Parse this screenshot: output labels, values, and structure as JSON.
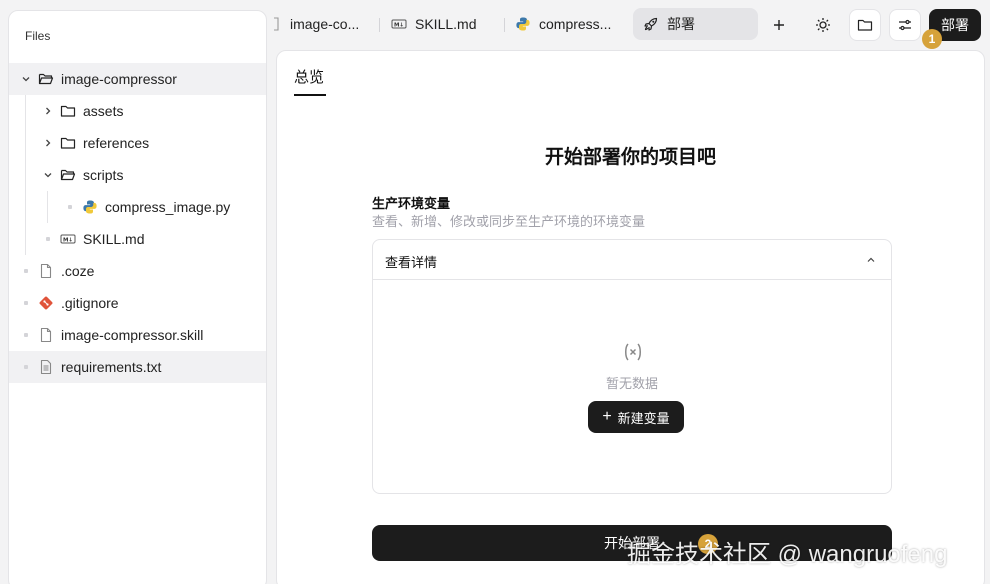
{
  "sidebar": {
    "title": "Files",
    "tree": [
      {
        "label": "image-compressor",
        "type": "folder-open",
        "expanded": true,
        "selected": true
      },
      {
        "label": "assets",
        "type": "folder"
      },
      {
        "label": "references",
        "type": "folder"
      },
      {
        "label": "scripts",
        "type": "folder-open",
        "expanded": true
      },
      {
        "label": "compress_image.py",
        "type": "python-file"
      },
      {
        "label": "SKILL.md",
        "type": "markdown-file"
      },
      {
        "label": ".coze",
        "type": "file"
      },
      {
        "label": ".gitignore",
        "type": "git-file"
      },
      {
        "label": "image-compressor.skill",
        "type": "file"
      },
      {
        "label": "requirements.txt",
        "type": "text-file",
        "hovered": true
      }
    ]
  },
  "tabs": [
    {
      "label": "image-co...",
      "icon": "file-icon"
    },
    {
      "label": "SKILL.md",
      "icon": "markdown-icon"
    },
    {
      "label": "compress...",
      "icon": "python-icon"
    },
    {
      "label": "部署",
      "icon": "rocket-icon",
      "active": true
    }
  ],
  "toolbar": {
    "add_icon": "plus-icon",
    "theme_icon": "sun-icon",
    "folder_icon": "folder-icon",
    "settings_icon": "sliders-icon",
    "deploy_label": "部署",
    "badge_1": "1"
  },
  "main": {
    "tab_label": "总览",
    "heading": "开始部署你的项目吧",
    "env_title": "生产环境变量",
    "env_subtitle": "查看、新增、修改或同步至生产环境的环境变量",
    "details_label": "查看详情",
    "empty_text": "暂无数据",
    "new_var_label": "新建变量",
    "start_label": "开始部署",
    "badge_2": "2"
  },
  "watermark": "掘金技术社区 @ wangruofeng",
  "colors": {
    "accent_dark": "#1c1c1c",
    "badge": "#d6a23a",
    "muted": "#a1a1aa"
  }
}
